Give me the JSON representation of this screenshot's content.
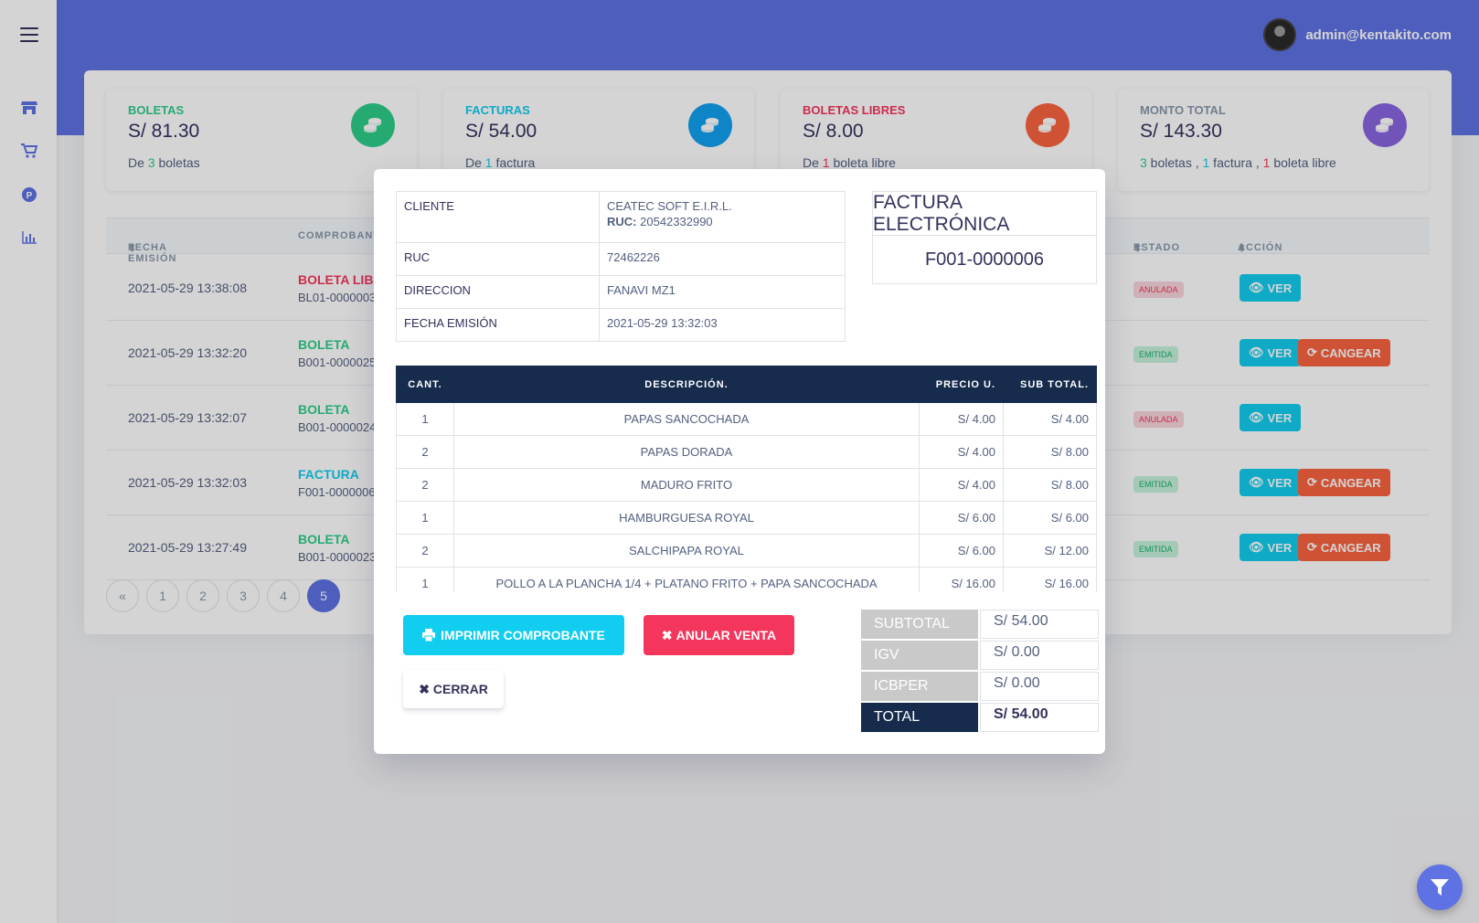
{
  "header": {
    "user_email": "admin@kentakito.com"
  },
  "sidebar": {
    "icons": [
      "menu-icon",
      "store-icon",
      "cart-icon",
      "parking-icon",
      "chart-icon"
    ]
  },
  "stats": [
    {
      "title": "BOLETAS",
      "value": "S/ 81.30",
      "color": "#2dce89",
      "sub_pre": "De ",
      "sub_num": "3",
      "sub_post": " boletas"
    },
    {
      "title": "FACTURAS",
      "value": "S/ 54.00",
      "color": "#11cdef",
      "sub_pre": "De ",
      "sub_num": "1",
      "sub_post": " factura"
    },
    {
      "title": "BOLETAS LIBRES",
      "value": "S/ 8.00",
      "color": "#fb6340",
      "sub_pre": "De ",
      "sub_num": "1",
      "sub_post": " boleta libre"
    },
    {
      "title": "MONTO TOTAL",
      "value": "S/ 143.30",
      "color": "#8965e0",
      "sub": {
        "n1": "3",
        "t1": " boletas , ",
        "n2": "1",
        "t2": " factura , ",
        "n3": "1",
        "t3": " boleta libre"
      }
    }
  ],
  "table": {
    "headers": {
      "fecha": "FECHA EMISIÓN",
      "comprobante": "COMPROBANTE",
      "estado": "ESTADO",
      "accion": "ACCIÓN"
    },
    "rows": [
      {
        "date": "2021-05-29 13:38:08",
        "type": "BOLETA LIBRE",
        "type_color": "#f5365c",
        "num": "BL01-0000003",
        "status": "ANULADA",
        "status_class": "anulada",
        "ver": "VER",
        "canjear": ""
      },
      {
        "date": "2021-05-29 13:32:20",
        "type": "BOLETA",
        "type_color": "#2dce89",
        "num": "B001-0000025",
        "status": "EMITIDA",
        "status_class": "emitida",
        "ver": "VER",
        "canjear": "CANGEAR"
      },
      {
        "date": "2021-05-29 13:32:07",
        "type": "BOLETA",
        "type_color": "#2dce89",
        "num": "B001-0000024",
        "status": "ANULADA",
        "status_class": "anulada",
        "ver": "VER",
        "canjear": ""
      },
      {
        "date": "2021-05-29 13:32:03",
        "type": "FACTURA",
        "type_color": "#11cdef",
        "num": "F001-0000006",
        "status": "EMITIDA",
        "status_class": "emitida",
        "ver": "VER",
        "canjear": "CANGEAR"
      },
      {
        "date": "2021-05-29 13:27:49",
        "type": "BOLETA",
        "type_color": "#2dce89",
        "num": "B001-0000023",
        "status": "EMITIDA",
        "status_class": "emitida",
        "ver": "VER",
        "canjear": "CANGEAR"
      }
    ],
    "pagination": {
      "prev": "«",
      "pages": [
        "1",
        "2",
        "3",
        "4",
        "5"
      ],
      "active": "5"
    }
  },
  "modal": {
    "info": {
      "cliente_label": "CLIENTE",
      "cliente_name": "CEATEC SOFT E.I.R.L.",
      "ruc_inline_label": "RUC:",
      "ruc_inline_value": "20542332990",
      "ruc_label": "RUC",
      "ruc_value": "72462226",
      "direccion_label": "DIRECCION",
      "direccion_value": "FANAVI MZ1",
      "fecha_label": "FECHA EMISIÓN",
      "fecha_value": "2021-05-29 13:32:03"
    },
    "invoice_title": "FACTURA ELECTRÓNICA",
    "invoice_number": "F001-0000006",
    "items_headers": {
      "cant": "CANT.",
      "desc": "DESCRIPCIÓN.",
      "pu": "PRECIO U.",
      "st": "SUB TOTAL."
    },
    "items": [
      {
        "cant": "1",
        "desc": "PAPAS SANCOCHADA",
        "pu": "S/ 4.00",
        "st": "S/ 4.00"
      },
      {
        "cant": "2",
        "desc": "PAPAS DORADA",
        "pu": "S/ 4.00",
        "st": "S/ 8.00"
      },
      {
        "cant": "2",
        "desc": "MADURO FRITO",
        "pu": "S/ 4.00",
        "st": "S/ 8.00"
      },
      {
        "cant": "1",
        "desc": "HAMBURGUESA ROYAL",
        "pu": "S/ 6.00",
        "st": "S/ 6.00"
      },
      {
        "cant": "2",
        "desc": "SALCHIPAPA ROYAL",
        "pu": "S/ 6.00",
        "st": "S/ 12.00"
      },
      {
        "cant": "1",
        "desc": "POLLO A LA PLANCHA 1/4 + PLATANO FRITO + PAPA SANCOCHADA",
        "pu": "S/ 16.00",
        "st": "S/ 16.00"
      }
    ],
    "buttons": {
      "print": "IMPRIMIR COMPROBANTE",
      "anular": "ANULAR VENTA",
      "cerrar": "CERRAR"
    },
    "totals": [
      {
        "label": "SUBTOTAL",
        "value": "S/ 54.00"
      },
      {
        "label": "IGV",
        "value": "S/ 0.00"
      },
      {
        "label": "ICBPER",
        "value": "S/ 0.00"
      },
      {
        "label": "TOTAL",
        "value": "S/ 54.00"
      }
    ]
  },
  "fab": {
    "icon": "filter-icon"
  }
}
